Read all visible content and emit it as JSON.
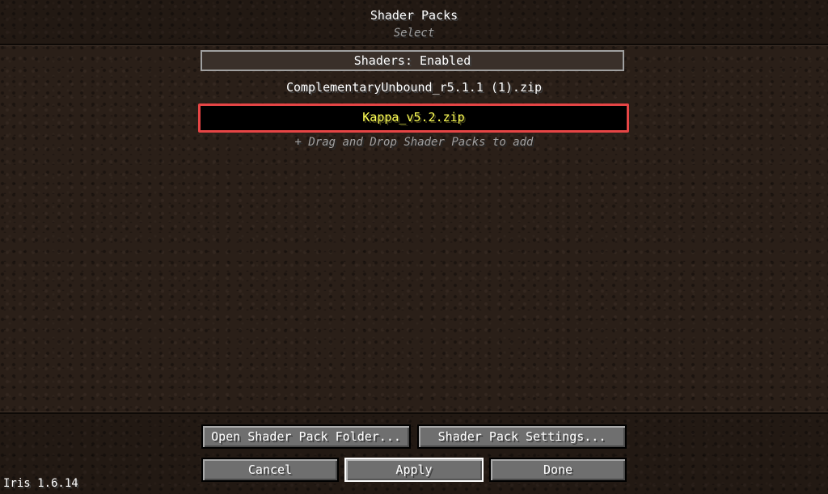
{
  "header": {
    "title": "Shader Packs",
    "subtitle": "Select"
  },
  "toggle": {
    "label": "Shaders: Enabled"
  },
  "packs": [
    {
      "name": "ComplementaryUnbound_r5.1.1 (1).zip",
      "selected": false
    },
    {
      "name": "Kappa_v5.2.zip",
      "selected": true
    }
  ],
  "hint": "+ Drag and Drop Shader Packs to add",
  "buttons": {
    "open_folder": "Open Shader Pack Folder...",
    "settings": "Shader Pack Settings...",
    "cancel": "Cancel",
    "apply": "Apply",
    "done": "Done"
  },
  "version": "Iris 1.6.14",
  "colors": {
    "selected_text": "#ffff55",
    "selected_border": "#e64545",
    "secondary_text": "#a0a0a0"
  }
}
